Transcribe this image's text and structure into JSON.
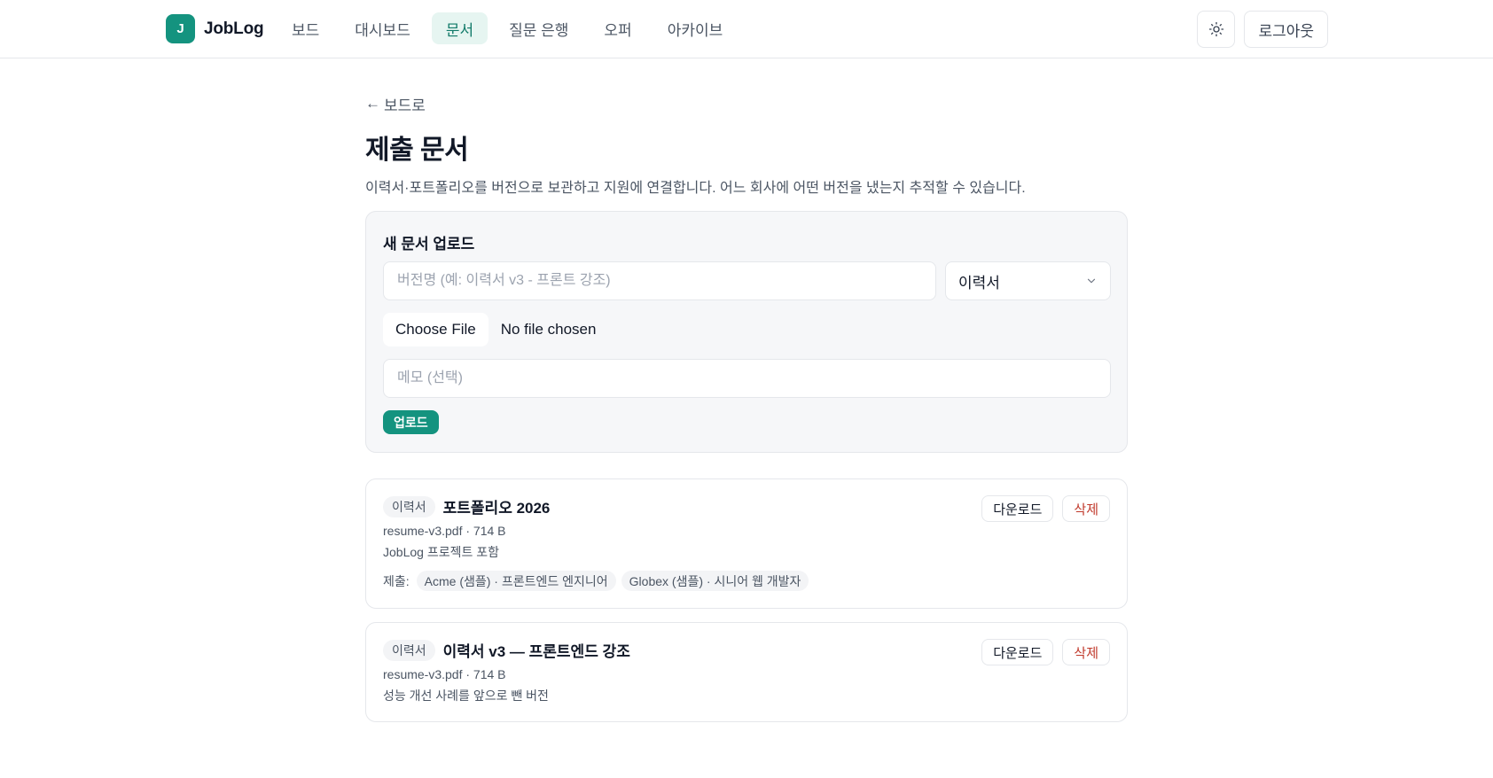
{
  "app": {
    "logo_letter": "J",
    "name": "JobLog"
  },
  "nav": {
    "items": [
      {
        "label": "보드"
      },
      {
        "label": "대시보드"
      },
      {
        "label": "문서",
        "active": true
      },
      {
        "label": "질문 은행"
      },
      {
        "label": "오퍼"
      },
      {
        "label": "아카이브"
      }
    ]
  },
  "header": {
    "theme_icon": "sun-icon",
    "logout_label": "로그아웃"
  },
  "page": {
    "back_label": "보드로",
    "back_icon": "arrow-left-icon",
    "title": "제출 문서",
    "description": "이력서·포트폴리오를 버전으로 보관하고 지원에 연결합니다. 어느 회사에 어떤 버전을 냈는지 추적할 수 있습니다."
  },
  "upload": {
    "title": "새 문서 업로드",
    "version_placeholder": "버전명 (예: 이력서 v3 - 프론트 강조)",
    "version_value": "",
    "type_selected": "이력서",
    "file_button": "Choose File",
    "file_status": "No file chosen",
    "memo_placeholder": "메모 (선택)",
    "memo_value": "",
    "submit_label": "업로드"
  },
  "documents": [
    {
      "type": "이력서",
      "title": "포트폴리오 2026",
      "meta": "resume-v3.pdf · 714 B",
      "memo": "JobLog 프로젝트 포함",
      "submissions_label": "제출:",
      "submissions": [
        "Acme (샘플) · 프론트엔드 엔지니어",
        "Globex (샘플) · 시니어 웹 개발자"
      ],
      "download_label": "다운로드",
      "delete_label": "삭제"
    },
    {
      "type": "이력서",
      "title": "이력서 v3 — 프론트엔드 강조",
      "meta": "resume-v3.pdf · 714 B",
      "memo": "성능 개선 사례를 앞으로 뺀 버전",
      "download_label": "다운로드",
      "delete_label": "삭제"
    }
  ],
  "colors": {
    "accent": "#14937f",
    "accent_soft": "#e6f5f1",
    "danger": "#c0392b"
  }
}
